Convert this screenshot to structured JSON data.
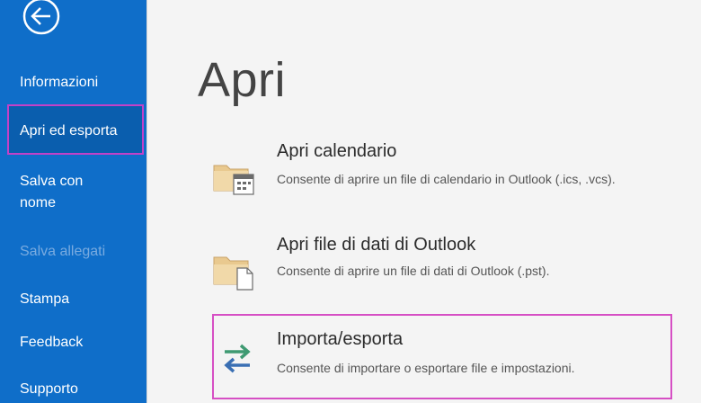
{
  "sidebar": {
    "items": [
      {
        "label": "Informazioni"
      },
      {
        "label": "Apri ed esporta"
      },
      {
        "label": "Salva con nome"
      },
      {
        "label": "Salva allegati"
      },
      {
        "label": "Stampa"
      },
      {
        "label": "Feedback"
      },
      {
        "label": "Supporto"
      }
    ]
  },
  "main": {
    "title": "Apri",
    "options": [
      {
        "title": "Apri calendario",
        "description": "Consente di aprire un file di calendario in Outlook (.ics, .vcs)."
      },
      {
        "title": "Apri file di dati di Outlook",
        "description": "Consente di aprire un file di dati di Outlook (.pst)."
      },
      {
        "title": "Importa/esporta",
        "description": "Consente di importare o esportare file e impostazioni."
      }
    ]
  },
  "colors": {
    "sidebar": "#0f6ec9",
    "highlight": "#d64fc4"
  }
}
